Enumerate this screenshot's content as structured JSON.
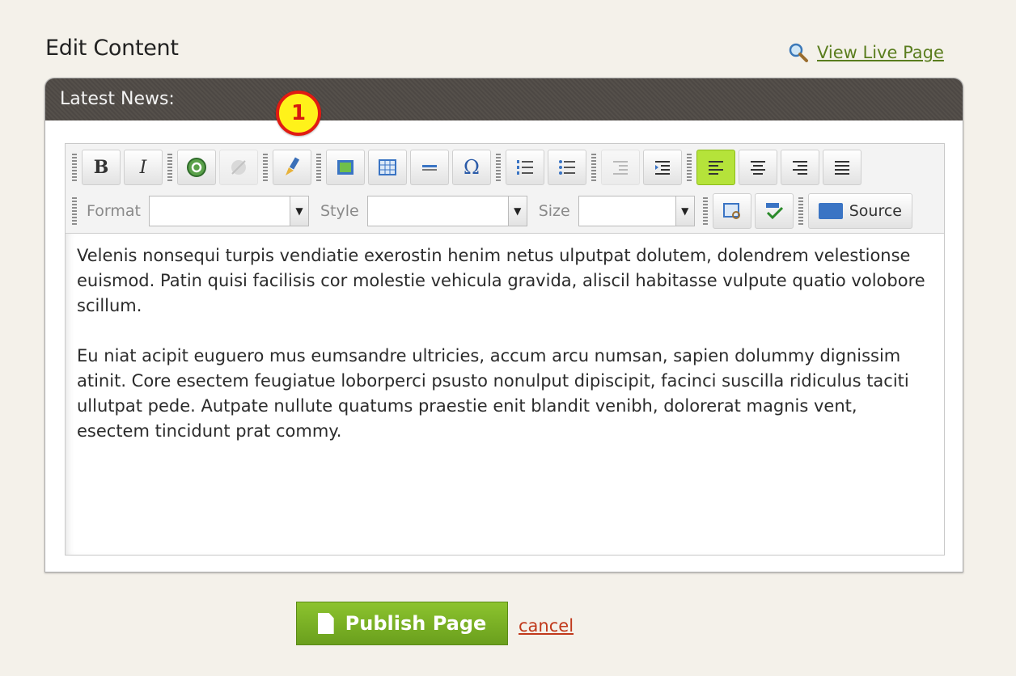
{
  "page": {
    "title": "Edit Content",
    "view_live_label": "View Live Page"
  },
  "panel": {
    "header": "Latest News:",
    "step_badge": "1"
  },
  "toolbar": {
    "bold": "B",
    "italic": "I",
    "omega": "Ω",
    "format_label": "Format",
    "format_value": "",
    "style_label": "Style",
    "style_value": "",
    "size_label": "Size",
    "size_value": "",
    "source_label": "Source",
    "icons": [
      "bold-icon",
      "italic-icon",
      "link-icon",
      "unlink-icon",
      "paint-brush-icon",
      "image-icon",
      "table-icon",
      "horizontal-rule-icon",
      "special-char-icon",
      "numbered-list-icon",
      "bulleted-list-icon",
      "outdent-icon",
      "indent-icon",
      "align-left-icon",
      "align-center-icon",
      "align-right-icon",
      "justify-icon",
      "find-replace-icon",
      "spellcheck-icon",
      "source-icon"
    ]
  },
  "content": {
    "paragraphs": [
      "Velenis nonsequi turpis vendiatie exerostin henim netus ulputpat dolutem, dolendrem velestionse euismod. Patin quisi facilisis cor molestie vehicula gravida, aliscil habitasse vulpute quatio volobore scillum.",
      "Eu niat acipit euguero mus eumsandre ultricies, accum arcu numsan, sapien dolummy dignissim atinit. Core esectem feugiatue loborperci psusto nonulput dipiscipit, facinci suscilla ridiculus taciti ullutpat pede. Autpate nullute quatums praestie enit blandit venibh, dolorerat magnis vent, esectem tincidunt prat commy."
    ]
  },
  "actions": {
    "publish_label": "Publish Page",
    "cancel_label": "cancel"
  },
  "colors": {
    "accent_green": "#6a9f1d",
    "header_dark": "#514c48",
    "cancel_red": "#c0391b",
    "link_green": "#5a7d1e",
    "active_tool": "#b5e33a"
  }
}
